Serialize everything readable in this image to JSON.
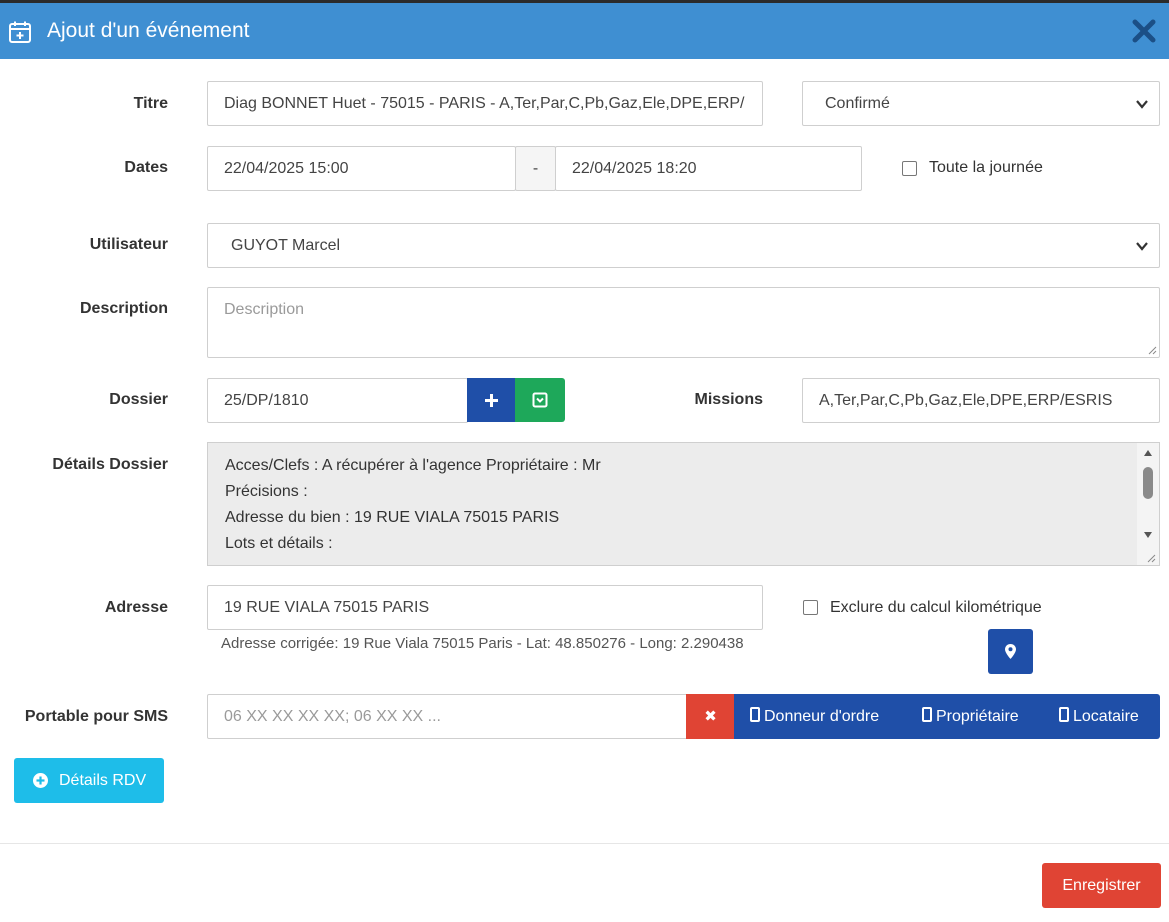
{
  "dialog": {
    "title": "Ajout d'un événement"
  },
  "labels": {
    "titre": "Titre",
    "dates": "Dates",
    "utilisateur": "Utilisateur",
    "description": "Description",
    "dossier": "Dossier",
    "missions": "Missions",
    "details_dossier": "Détails Dossier",
    "adresse": "Adresse",
    "portable_sms": "Portable pour SMS"
  },
  "fields": {
    "titre_value": "Diag BONNET Huet - 75015 - PARIS - A,Ter,Par,C,Pb,Gaz,Ele,DPE,ERP/",
    "status_value": "Confirmé",
    "date_start": "22/04/2025 15:00",
    "date_separator": "-",
    "date_end": "22/04/2025 18:20",
    "all_day_label": "Toute la journée",
    "utilisateur_value": "GUYOT Marcel",
    "description_placeholder": "Description",
    "dossier_value": "25/DP/1810",
    "missions_value": "A,Ter,Par,C,Pb,Gaz,Ele,DPE,ERP/ESRIS",
    "details_lines": [
      "Acces/Clefs : A récupérer à l'agence Propriétaire : Mr",
      "Précisions :",
      "Adresse du bien : 19 RUE VIALA 75015 PARIS",
      "Lots et détails :"
    ],
    "adresse_value": "19 RUE VIALA 75015 PARIS",
    "exclude_km_label": "Exclure du calcul kilométrique",
    "corrected_address": "Adresse corrigée: 19 Rue Viala 75015 Paris - Lat: 48.850276 - Long: 2.290438",
    "sms_placeholder": "06 XX XX XX XX; 06 XX XX ..."
  },
  "buttons": {
    "clear_symbol": "✖",
    "donneur": "Donneur d'ordre",
    "proprietaire": "Propriétaire",
    "locataire": "Locataire",
    "details_rdv": "Détails RDV",
    "save": "Enregistrer"
  },
  "colors": {
    "header": "#3f8fd2",
    "blue_button": "#1f4fa8",
    "green_button": "#1ea85a",
    "red_button": "#e04434",
    "cyan_button": "#1ebde9"
  }
}
